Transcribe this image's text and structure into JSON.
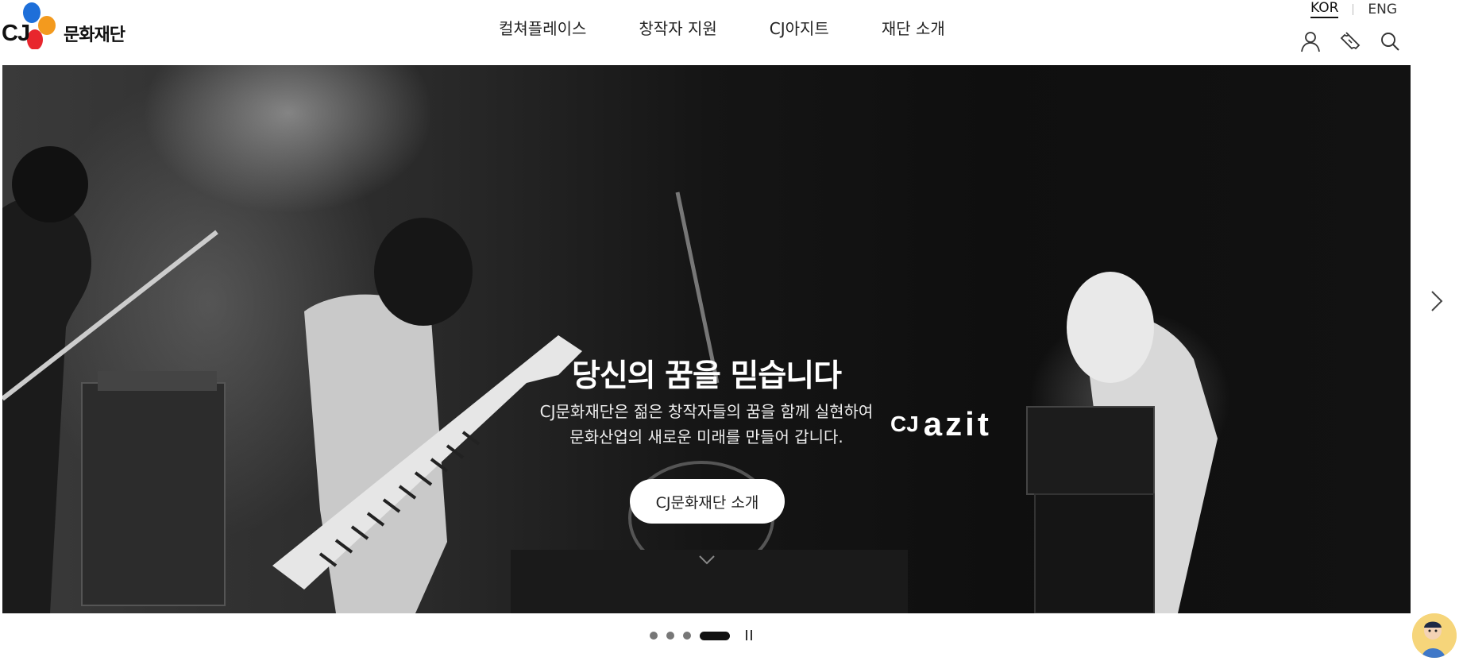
{
  "header": {
    "logo": {
      "cj": "CJ",
      "brand": "문화재단"
    },
    "nav": [
      {
        "label": "컬쳐플레이스"
      },
      {
        "label": "창작자 지원"
      },
      {
        "label": "CJ아지트"
      },
      {
        "label": "재단 소개"
      }
    ],
    "lang": {
      "kor": "KOR",
      "eng": "ENG",
      "selected": "KOR"
    },
    "icons": [
      "user-icon",
      "ticket-icon",
      "search-icon"
    ]
  },
  "hero": {
    "title": "당신의 꿈을 믿습니다",
    "desc_line1": "CJ문화재단은 젊은 창작자들의 꿈을 함께 실현하여",
    "desc_line2": "문화산업의 새로운 미래를 만들어 갑니다.",
    "button": "CJ문화재단 소개",
    "watermark_cj": "CJ",
    "watermark_azit": "azit"
  },
  "slider": {
    "total": 4,
    "active_index": 4,
    "state": "playing"
  },
  "colors": {
    "logo_blue": "#1e6fd9",
    "logo_orange": "#f39a1e",
    "logo_red": "#e8262d"
  }
}
